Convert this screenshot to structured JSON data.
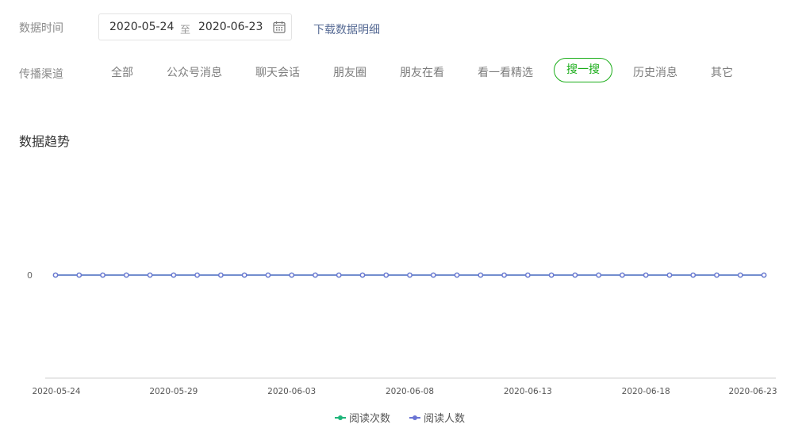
{
  "filter": {
    "date_label": "数据时间",
    "date_start": "2020-05-24",
    "date_sep": "至",
    "date_end": "2020-06-23",
    "download_link": "下载数据明细",
    "channel_label": "传播渠道",
    "channels": [
      "全部",
      "公众号消息",
      "聊天会话",
      "朋友圈",
      "朋友在看",
      "看一看精选",
      "搜一搜",
      "历史消息",
      "其它"
    ],
    "active_channel": "搜一搜"
  },
  "section_title": "数据趋势",
  "colors": {
    "accent": "#1aad19",
    "series_read_count": "#1fb57a",
    "series_read_users": "#6a74d4"
  },
  "chart_data": {
    "type": "line",
    "x": [
      "2020-05-24",
      "2020-05-25",
      "2020-05-26",
      "2020-05-27",
      "2020-05-28",
      "2020-05-29",
      "2020-05-30",
      "2020-05-31",
      "2020-06-01",
      "2020-06-02",
      "2020-06-03",
      "2020-06-04",
      "2020-06-05",
      "2020-06-06",
      "2020-06-07",
      "2020-06-08",
      "2020-06-09",
      "2020-06-10",
      "2020-06-11",
      "2020-06-12",
      "2020-06-13",
      "2020-06-14",
      "2020-06-15",
      "2020-06-16",
      "2020-06-17",
      "2020-06-18",
      "2020-06-19",
      "2020-06-20",
      "2020-06-21",
      "2020-06-22",
      "2020-06-23"
    ],
    "x_ticks": [
      "2020-05-24",
      "2020-05-29",
      "2020-06-03",
      "2020-06-08",
      "2020-06-13",
      "2020-06-18",
      "2020-06-23"
    ],
    "y_ticks": [
      0
    ],
    "series": [
      {
        "name": "阅读次数",
        "values": [
          0,
          0,
          0,
          0,
          0,
          0,
          0,
          0,
          0,
          0,
          0,
          0,
          0,
          0,
          0,
          0,
          0,
          0,
          0,
          0,
          0,
          0,
          0,
          0,
          0,
          0,
          0,
          0,
          0,
          0,
          0
        ]
      },
      {
        "name": "阅读人数",
        "values": [
          0,
          0,
          0,
          0,
          0,
          0,
          0,
          0,
          0,
          0,
          0,
          0,
          0,
          0,
          0,
          0,
          0,
          0,
          0,
          0,
          0,
          0,
          0,
          0,
          0,
          0,
          0,
          0,
          0,
          0,
          0
        ]
      }
    ],
    "grid": false,
    "legend_position": "bottom-center"
  }
}
